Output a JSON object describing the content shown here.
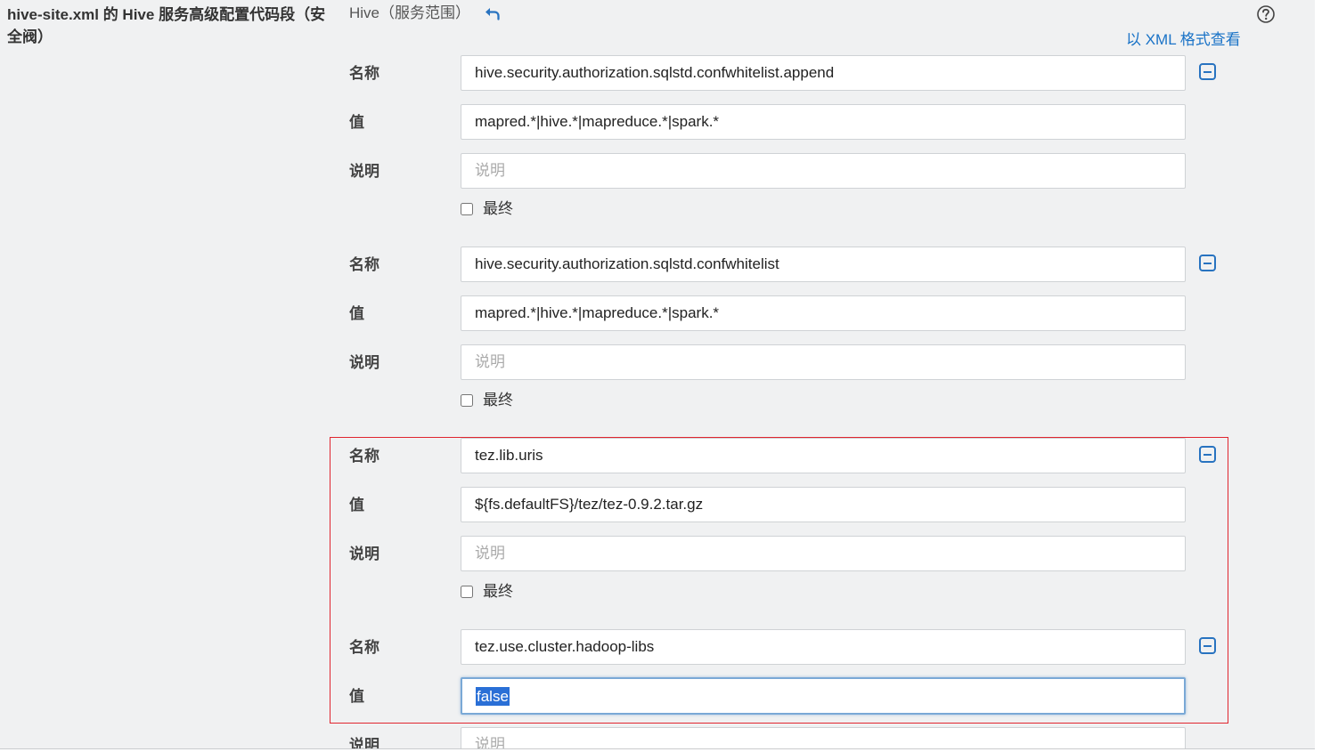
{
  "header": {
    "section_title": "hive-site.xml 的 Hive 服务高级配置代码段（安全阀）",
    "scope": "Hive（服务范围）",
    "view_as_xml": "以 XML 格式查看"
  },
  "labels": {
    "name": "名称",
    "value": "值",
    "description": "说明",
    "final": "最终"
  },
  "properties": [
    {
      "name": "hive.security.authorization.sqlstd.confwhitelist.append",
      "value": "mapred.*|hive.*|mapreduce.*|spark.*",
      "description": "",
      "description_placeholder": "说明",
      "final": false
    },
    {
      "name": "hive.security.authorization.sqlstd.confwhitelist",
      "value": "mapred.*|hive.*|mapreduce.*|spark.*",
      "description": "",
      "description_placeholder": "说明",
      "final": false
    },
    {
      "name": "tez.lib.uris",
      "value": "${fs.defaultFS}/tez/tez-0.9.2.tar.gz",
      "description": "",
      "description_placeholder": "说明",
      "final": false
    },
    {
      "name": "tez.use.cluster.hadoop-libs",
      "value": "false",
      "description": "",
      "description_placeholder": "说明",
      "final": false
    }
  ],
  "colors": {
    "link": "#1a73c7",
    "highlight_border": "#e0262f",
    "selection": "#2a6fd6",
    "background": "#f0f1f2"
  }
}
